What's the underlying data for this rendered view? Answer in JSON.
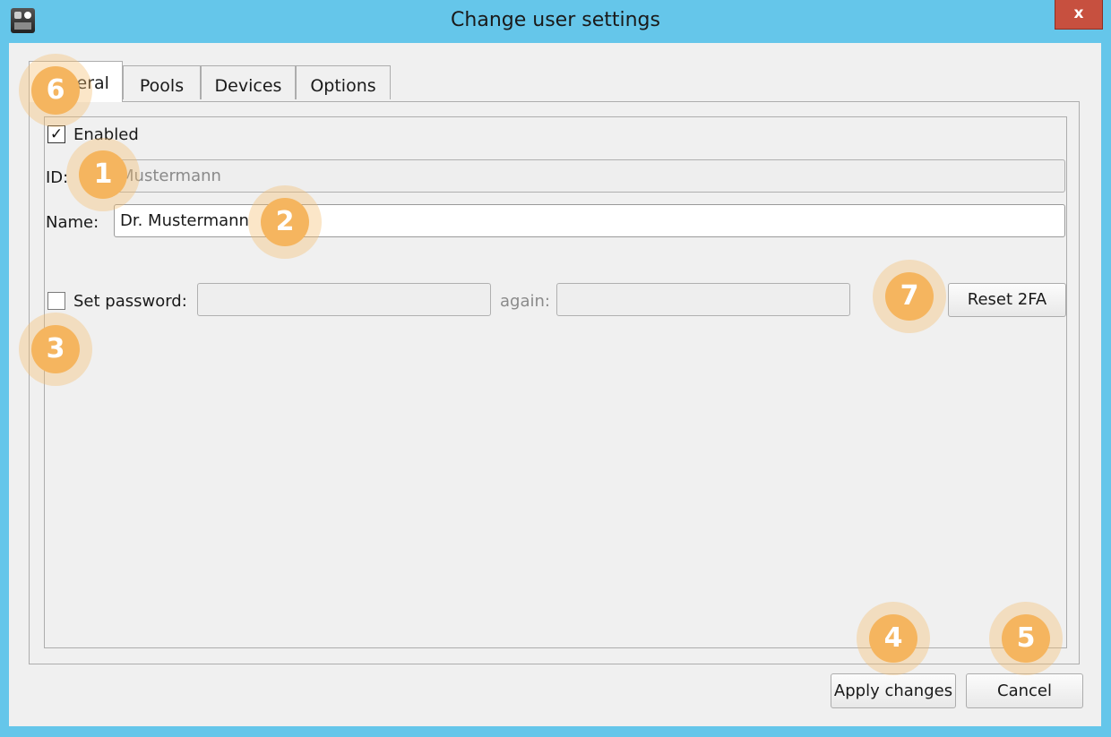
{
  "window": {
    "title": "Change user settings",
    "close_label": "x"
  },
  "tabs": [
    {
      "label": "General",
      "active": true
    },
    {
      "label": "Pools",
      "active": false
    },
    {
      "label": "Devices",
      "active": false
    },
    {
      "label": "Options",
      "active": false
    }
  ],
  "general": {
    "enabled": {
      "label": "Enabled",
      "checked": true,
      "mark": "✓"
    },
    "id": {
      "label": "ID:",
      "value": "Mustermann",
      "disabled": true
    },
    "name": {
      "label": "Name:",
      "value": "Dr. Mustermann"
    },
    "set_password": {
      "label": "Set password:",
      "checked": false,
      "again_label": "again:"
    },
    "reset_2fa_label": "Reset 2FA"
  },
  "footer": {
    "apply_label": "Apply changes",
    "cancel_label": "Cancel"
  },
  "callouts": [
    "1",
    "2",
    "3",
    "4",
    "5",
    "6",
    "7"
  ],
  "colors": {
    "titlebar": "#65c6ea",
    "close_button": "#c7503f",
    "callout": "#f5b55f"
  }
}
